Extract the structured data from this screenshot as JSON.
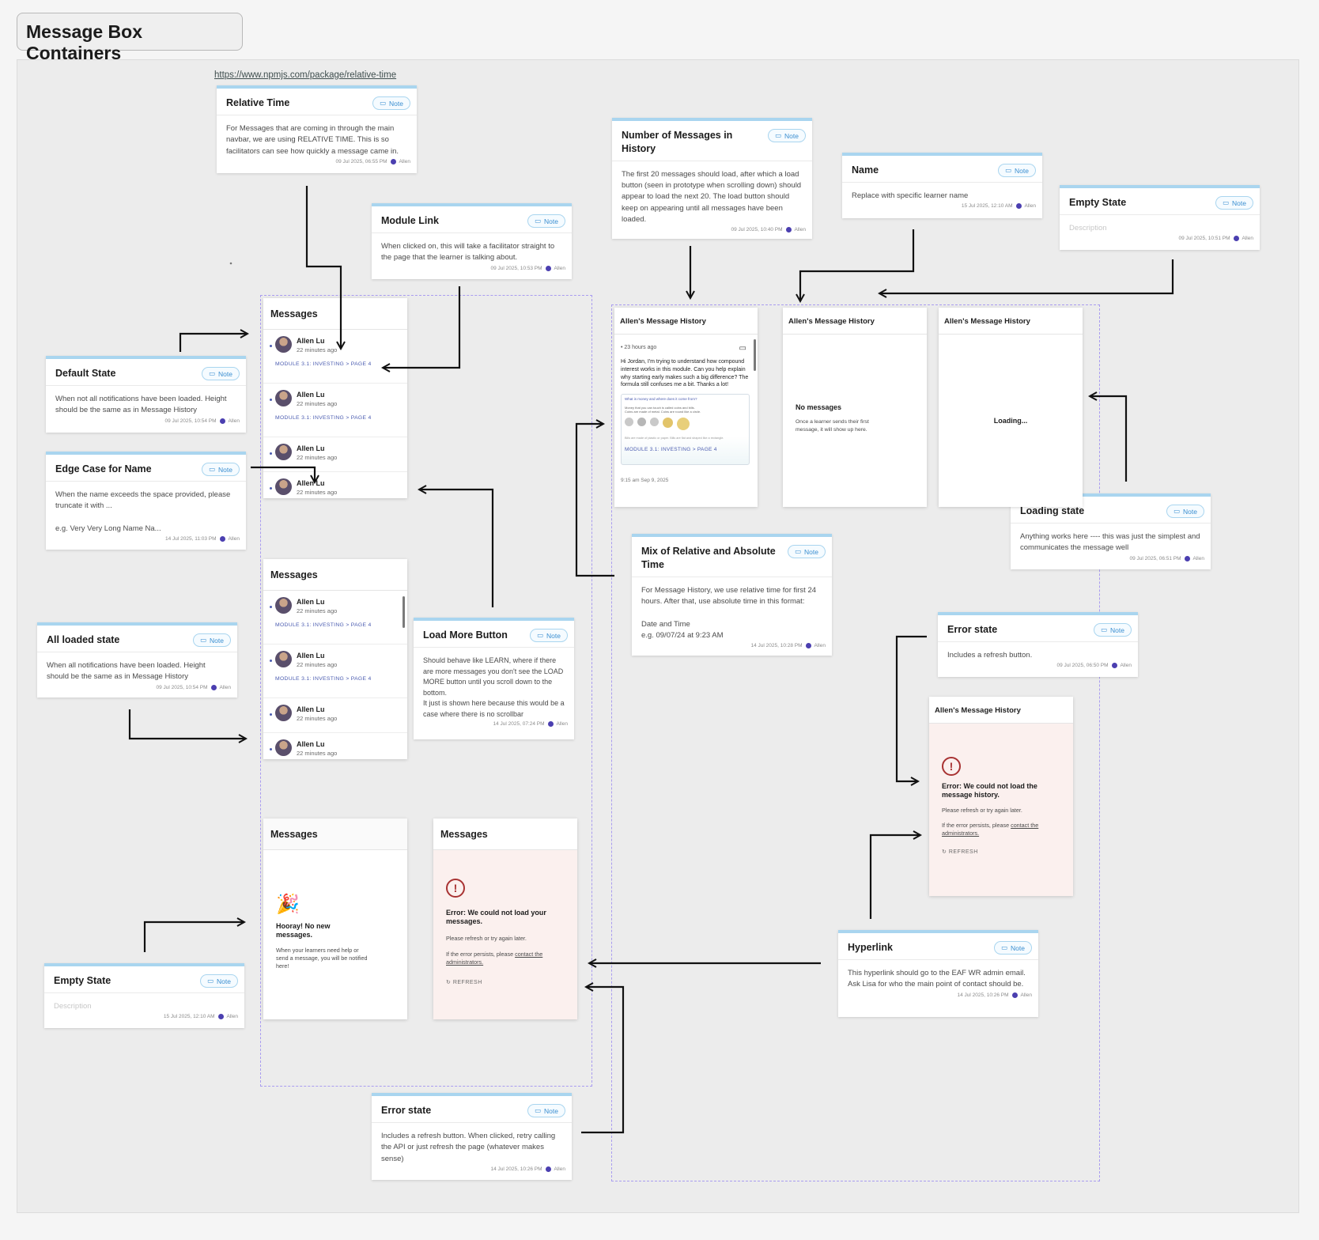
{
  "frame": {
    "title": "Message Box Containers"
  },
  "link": {
    "url_text": "https://www.npmjs.com/package/relative-time"
  },
  "common": {
    "note_badge": "Note",
    "author": "Allen"
  },
  "notes": {
    "relative_time": {
      "title": "Relative Time",
      "body": "For Messages that are coming in through the main navbar, we are using RELATIVE TIME. This is so facilitators can see how quickly a message came in.",
      "time": "09 Jul 2025, 06:55 PM"
    },
    "module_link": {
      "title": "Module Link",
      "body": "When clicked on, this will take a facilitator straight to the page that the learner is talking about.",
      "time": "09 Jul 2025, 10:53 PM"
    },
    "num_messages": {
      "title": "Number of Messages in History",
      "body": "The first 20 messages should load, after which a load button (seen in prototype when scrolling down) should appear to load the next 20. The load button should keep on appearing until all messages have been loaded.",
      "time": "09 Jul 2025, 10:40 PM"
    },
    "name": {
      "title": "Name",
      "body": "Replace with specific learner name",
      "time": "15 Jul 2025, 12:10 AM"
    },
    "empty_state_top": {
      "title": "Empty State",
      "body": "Description",
      "time": "09 Jul 2025, 10:51 PM"
    },
    "default_state": {
      "title": "Default State",
      "body": "When not all notifications have been loaded. Height should be the same as in Message History",
      "time": "09 Jul 2025, 10:54 PM"
    },
    "edge_case": {
      "title": "Edge Case for Name",
      "body": "When the name exceeds the space provided, please truncate it with ...\n\ne.g. Very Very Long Name Na...",
      "time": "14 Jul 2025, 11:03 PM"
    },
    "all_loaded": {
      "title": "All loaded state",
      "body": "When all notifications have been loaded. Height should be the same as in Message History",
      "time": "09 Jul 2025, 10:54 PM"
    },
    "load_more": {
      "title": "Load More Button",
      "body": "Should behave like LEARN, where if there are more messages you don't see the LOAD MORE button until you scroll down to the bottom.\nIt just is shown here because this would be a case where there is no scrollbar",
      "time": "14 Jul 2025, 07:24 PM"
    },
    "mix_time": {
      "title": "Mix of Relative and Absolute Time",
      "body": "For Message History, we use relative time for first 24 hours. After that, use absolute time in this format:\n\nDate and Time\ne.g. 09/07/24 at 9:23 AM",
      "time": "14 Jul 2025, 10:28 PM"
    },
    "loading_state": {
      "title": "Loading state",
      "body": "Anything works here ---- this was just the simplest and communicates the message well",
      "time": "09 Jul 2025, 06:51 PM"
    },
    "error_state_right": {
      "title": "Error state",
      "body": "Includes a refresh button.",
      "time": "09 Jul 2025, 06:50 PM"
    },
    "empty_state_bottom": {
      "title": "Empty State",
      "body": "Description",
      "time": "15 Jul 2025, 12:10 AM"
    },
    "hyperlink": {
      "title": "Hyperlink",
      "body": "This hyperlink should go to the EAF WR admin email. Ask Lisa for who the main point of contact should be.",
      "time": "14 Jul 2025, 10:26 PM"
    },
    "error_state_bottom": {
      "title": "Error state",
      "body": "Includes a refresh button. When clicked, retry calling the API or just refresh the page (whatever makes sense)",
      "time": "14 Jul 2025, 10:26 PM"
    }
  },
  "messages_panel": {
    "title": "Messages",
    "name": "Allen Lu",
    "time": "22 minutes ago",
    "module_link": "MODULE 3.1: INVESTING > PAGE 4"
  },
  "empty_panel": {
    "title": "Messages",
    "heading": "Hooray! No new messages.",
    "text": "When your learners need help or send a message, you will be notified here!"
  },
  "error_panel": {
    "title": "Messages",
    "heading": "Error: We could not load your messages.",
    "retry": "Please refresh or try again later.",
    "persist_prefix": "If the error persists, please ",
    "persist_link": "contact the administrators.",
    "refresh": "REFRESH"
  },
  "history": {
    "title": "Allen's Message History",
    "msg_time": "23 hours ago",
    "msg_text": "Hi Jordan, I'm trying to understand how compound interest works in this module. Can you help explain why starting early makes such a big difference? The formula still confuses me a bit. Thanks a lot!",
    "thumb_q": "What is money and where does it come from?",
    "thumb_line1": "Money that you can touch is called coins and bills.",
    "thumb_line2": "Coins are made of metal. Coins are round like a circle.",
    "thumb_caption": "Bills are made of plastic or paper. Bills are flat and shaped like a rectangle.",
    "module_link": "MODULE 3.1: INVESTING > PAGE 4",
    "next_time": "9:15 am Sep 9, 2025",
    "no_messages_title": "No messages",
    "no_messages_text": "Once a learner sends their first message, it will show up here.",
    "loading": "Loading...",
    "error_heading": "Error: We could not load the message history.",
    "error_retry": "Please refresh or try again later.",
    "error_persist_prefix": "If the error persists, please ",
    "error_persist_link": "contact the administrators.",
    "error_refresh": "REFRESH"
  },
  "colors": {
    "note_accent": "#a9d5ef",
    "note_badge": "#3b8fd1",
    "group_border": "#a99cf0",
    "link": "#4b5cb0",
    "error": "#a83232",
    "error_bg": "#fbf0ee"
  },
  "icons": [
    "note-icon",
    "avatar",
    "chat-icon",
    "party-popper-icon",
    "alert-circle-icon",
    "refresh-icon"
  ]
}
